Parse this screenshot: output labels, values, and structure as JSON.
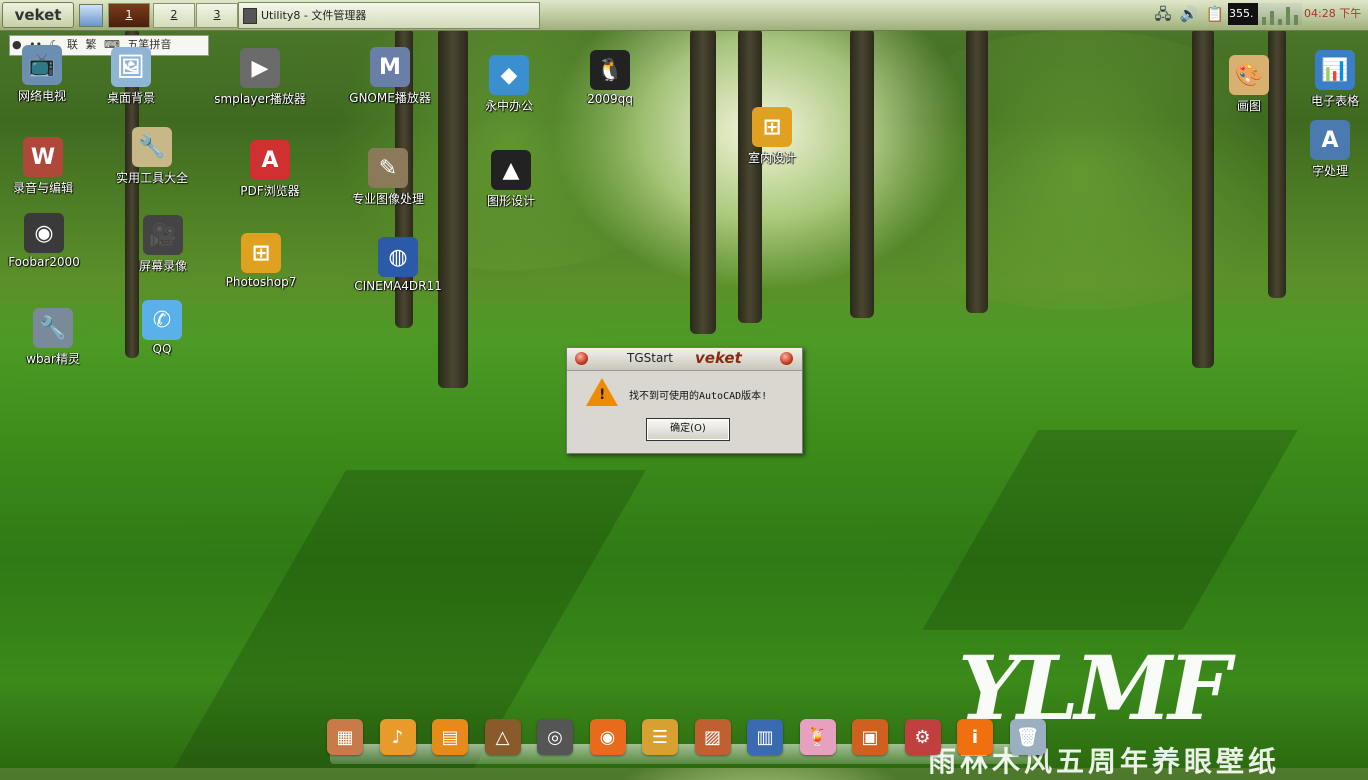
{
  "taskbar": {
    "start_label": "veket",
    "workspaces": [
      "1",
      "2",
      "3"
    ],
    "active_workspace": "1",
    "task_title": "Utility8 - 文件管理器",
    "cpu_label": "355.",
    "clock_time": "04:28",
    "clock_period": "下午"
  },
  "ime_bar": {
    "items": [
      "联",
      "繁",
      "五笔拼音"
    ]
  },
  "desktop_icons": [
    {
      "label": "网络电视",
      "icon": "tv-icon",
      "color": "#6a8fb0"
    },
    {
      "label": "桌面背景",
      "icon": "wallpaper-icon",
      "color": "#8fb5d5"
    },
    {
      "label": "smplayer播放器",
      "icon": "smplayer-icon",
      "color": "#6b6b6b"
    },
    {
      "label": "GNOME播放器",
      "icon": "gnome-player-icon",
      "color": "#6a7fa8"
    },
    {
      "label": "永中办公",
      "icon": "office-icon",
      "color": "#3a8fd0"
    },
    {
      "label": "2009qq",
      "icon": "qq-penguin-icon",
      "color": "#222222"
    },
    {
      "label": "画图",
      "icon": "paint-palette-icon",
      "color": "#d8b070"
    },
    {
      "label": "电子表格",
      "icon": "spreadsheet-icon",
      "color": "#3a7ec8"
    },
    {
      "label": "录音与编辑",
      "icon": "audio-edit-icon",
      "color": "#b0483a"
    },
    {
      "label": "实用工具大全",
      "icon": "toolbox-icon",
      "color": "#c8b888"
    },
    {
      "label": "PDF浏览器",
      "icon": "pdf-icon",
      "color": "#d03030"
    },
    {
      "label": "专业图像处理",
      "icon": "gimp-icon",
      "color": "#8a7a5a"
    },
    {
      "label": "图形设计",
      "icon": "inkscape-icon",
      "color": "#222222"
    },
    {
      "label": "室内设计",
      "icon": "windows-wine-icon",
      "color": "#e0a020"
    },
    {
      "label": "字处理",
      "icon": "word-processor-icon",
      "color": "#4a7ab0"
    },
    {
      "label": "Foobar2000",
      "icon": "foobar-icon",
      "color": "#3a3a3a"
    },
    {
      "label": "屏幕录像",
      "icon": "screen-record-icon",
      "color": "#444444"
    },
    {
      "label": "Photoshop7",
      "icon": "windows-wine-icon",
      "color": "#e0a020"
    },
    {
      "label": "CINEMA4DR11",
      "icon": "cinema4d-icon",
      "color": "#2a5aa8"
    },
    {
      "label": "wbar精灵",
      "icon": "wbar-settings-icon",
      "color": "#7a8a9a"
    },
    {
      "label": "QQ",
      "icon": "qq-bubble-icon",
      "color": "#5ab0e8"
    }
  ],
  "dialog": {
    "title": "TGStart",
    "brand": "veket",
    "message": "找不到可使用的AutoCAD版本!",
    "ok_label": "确定(O)"
  },
  "wallpaper": {
    "logo_text": "YLMF",
    "caption": "雨林木风五周年养眼壁纸"
  },
  "dock": {
    "icons": [
      "ruler-icon",
      "music-note-icon",
      "folder-icon",
      "triangle-tool-icon",
      "turntable-icon",
      "firefox-icon",
      "book-stack-icon",
      "image-viewer-icon",
      "chart-icon",
      "drink-icon",
      "book-icon",
      "settings-icon",
      "info-icon",
      "trash-icon"
    ],
    "colors": [
      "#c87a4a",
      "#e89a2a",
      "#e88a1a",
      "#8a5a2a",
      "#555555",
      "#e86a1a",
      "#d8a030",
      "#c06030",
      "#3a6ab0",
      "#e8a0c0",
      "#d06020",
      "#c04040",
      "#f07010",
      "#9ab0c0"
    ]
  }
}
